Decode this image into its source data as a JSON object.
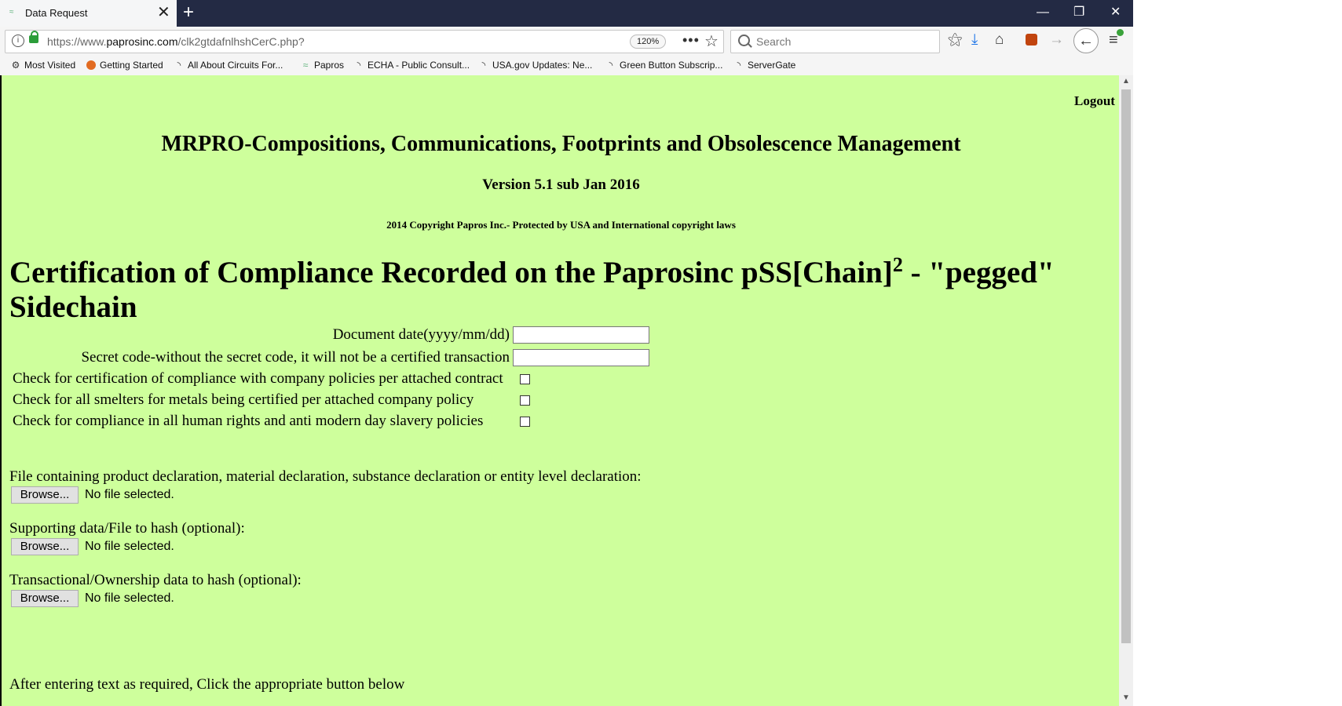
{
  "tab": {
    "title": "Data Request",
    "close": "✕",
    "new_tab": "+"
  },
  "window": {
    "minimize": "—",
    "restore": "❐",
    "close": "✕"
  },
  "address_bar": {
    "url_prefix": "https://www.",
    "url_domain": "paprosinc.com",
    "url_path": "/clk2gtdafnlhshCerC.php?",
    "zoom": "120%",
    "more": "•••",
    "bookmark_star": "☆"
  },
  "search": {
    "placeholder": "Search"
  },
  "toolbar": {
    "library": "⚝",
    "download": "⤓",
    "home": "⌂",
    "forward": "→",
    "back": "←",
    "menu": "≡"
  },
  "bookmarks": [
    {
      "label": "Most Visited",
      "icon": "gear-icon",
      "glyph": "⚙"
    },
    {
      "label": "Getting Started",
      "icon": "firefox-icon",
      "glyph": ""
    },
    {
      "label": "All About Circuits For...",
      "icon": "rss-icon",
      "glyph": "◝"
    },
    {
      "label": "Papros",
      "icon": "papros-icon",
      "glyph": "≈"
    },
    {
      "label": "ECHA - Public Consult...",
      "icon": "rss-icon",
      "glyph": "◝"
    },
    {
      "label": "USA.gov Updates: Ne...",
      "icon": "rss-icon",
      "glyph": "◝"
    },
    {
      "label": "Green Button Subscrip...",
      "icon": "rss-icon",
      "glyph": "◝"
    },
    {
      "label": "ServerGate",
      "icon": "rss-icon",
      "glyph": "◝"
    }
  ],
  "page": {
    "logout": "Logout",
    "app_title": "MRPRO-Compositions, Communications, Footprints and Obsolescence Management",
    "version": "Version 5.1 sub Jan 2016",
    "copyright": "2014 Copyright Papros Inc.- Protected by USA and International copyright laws",
    "cert_title_part1": "Certification of Compliance Recorded on the Paprosinc pSS[Chain]",
    "cert_title_sup": "2",
    "cert_title_part2": " - \"pegged\" Sidechain",
    "fields": {
      "doc_date_label": "Document date(yyyy/mm/dd)",
      "doc_date_value": "",
      "secret_code_label": "Secret code-without the secret code, it will not be a certified transaction",
      "secret_code_value": ""
    },
    "checks": {
      "contract": "Check for certification of compliance with company policies per attached contract",
      "smelters": "Check for all smelters for metals being certified per attached company policy",
      "human_rights": "Check for compliance in all human rights and anti modern day slavery policies"
    },
    "files": {
      "declaration_label": "File containing product declaration, material declaration, substance declaration or entity level declaration:",
      "supporting_label": "Supporting data/File to hash (optional):",
      "transactional_label": "Transactional/Ownership data to hash (optional):",
      "browse": "Browse...",
      "no_file": "No file selected."
    },
    "instructions": "After entering text as required, Click the appropriate button below"
  },
  "scrollbar": {
    "up": "▲",
    "down": "▼"
  }
}
